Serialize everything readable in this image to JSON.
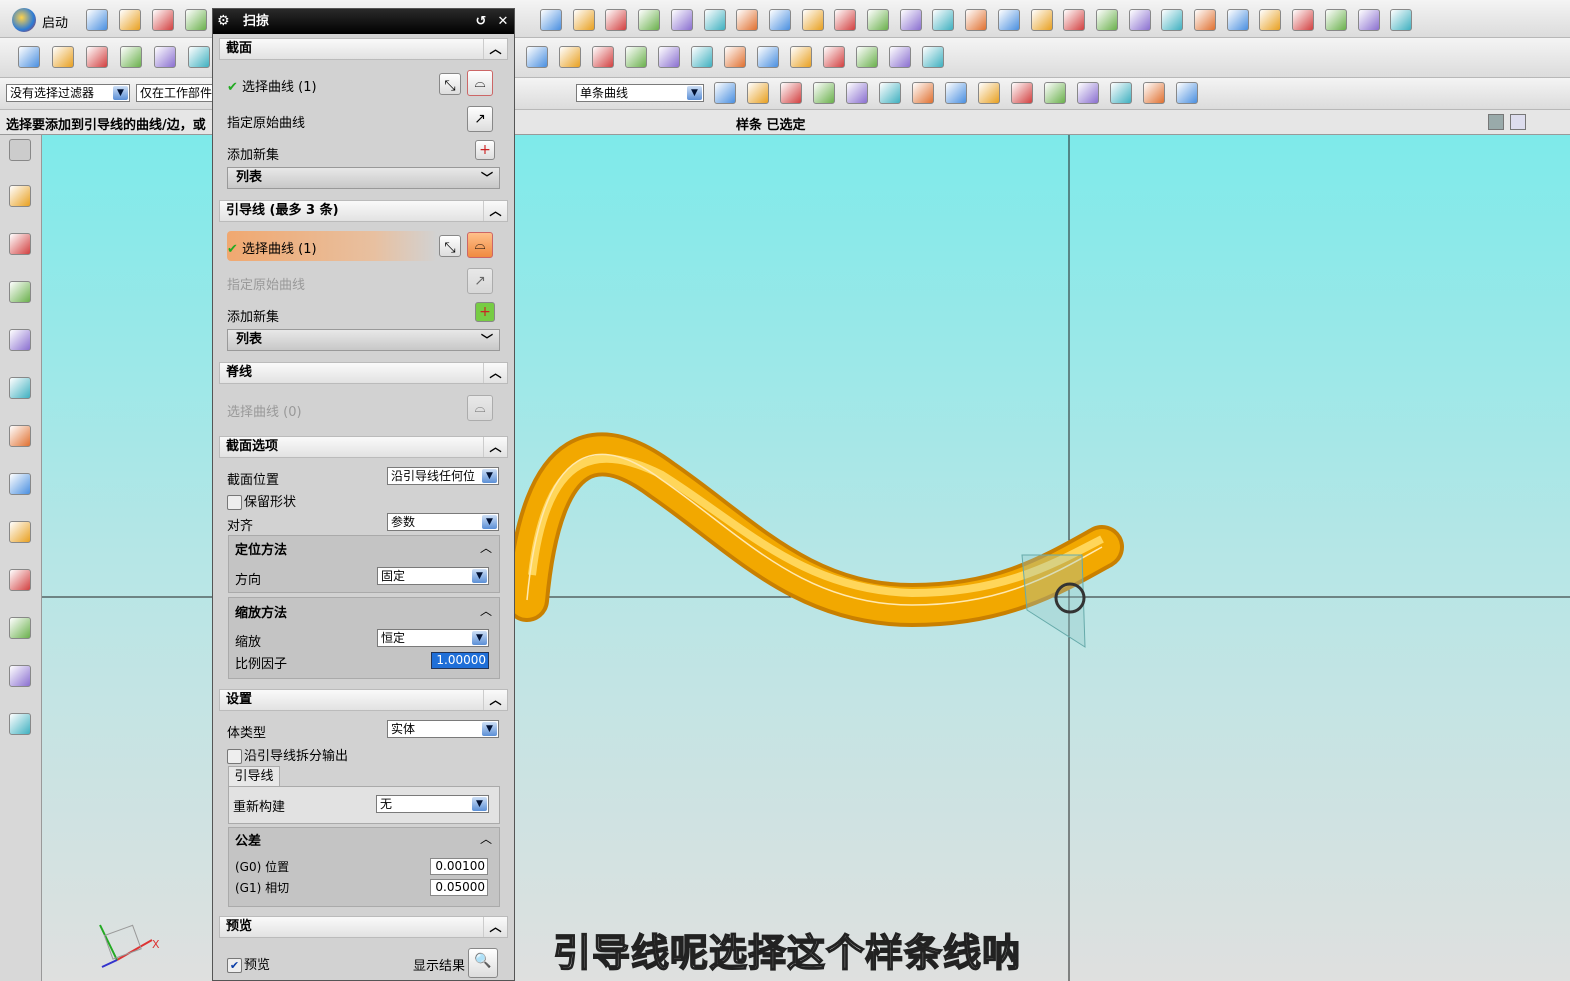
{
  "toolbar": {
    "start_label": "启动",
    "filter_value": "没有选择过滤器",
    "scope_value": "仅在工作部件",
    "curve_rule_value": "单条曲线",
    "row1_icons": [
      "new-file-icon",
      "open-folder-icon",
      "save-icon",
      "cut-icon"
    ],
    "row1_right_icons": [
      "fit-view-icon",
      "render-style-icon",
      "cube-view-icon",
      "background-icon",
      "move-icon",
      "rotate-icon",
      "sketch-icon",
      "trim-icon",
      "line-icon",
      "arc-icon",
      "shape-icon",
      "pattern-icon",
      "offset-icon",
      "book-icon",
      "ruler-icon",
      "surface-icon",
      "table-icon",
      "mesh-icon",
      "sweep-icon",
      "surface2-icon",
      "grid-icon",
      "cylinder-icon",
      "spline-icon",
      "csys-icon",
      "axis-icon",
      "box-icon",
      "block-icon"
    ],
    "row2_icons": [
      "rectangle-icon",
      "extrude-icon",
      "revolve-icon",
      "hole-icon",
      "pad-icon",
      "pattern-feature-icon"
    ],
    "row2_right_icons": [
      "ribbon-icon",
      "shell-icon",
      "boolean-icon",
      "unite-icon",
      "subtract-icon",
      "intersect-icon",
      "feature-icon",
      "edge-icon",
      "eye-icon",
      "measure-icon",
      "dimension-icon",
      "snap-icon",
      "analysis-icon"
    ],
    "row3_right_icons": [
      "stop-at-intersection-icon",
      "follow-fillet-icon",
      "arrow-right-icon",
      "snap-point-icon",
      "end-point-icon",
      "mid-point-icon",
      "control-point-icon",
      "intersection-icon",
      "quadrant-icon",
      "arc-center-icon",
      "tangent-icon",
      "point-on-curve-icon",
      "existing-point-icon",
      "face-icon",
      "grid-select-icon"
    ]
  },
  "statusbar": {
    "prompt": "选择要添加到引导线的曲线/边，或",
    "status": "样条 已选定"
  },
  "left_toolbar": [
    "settings-gear-icon",
    "assembly-navigator-icon",
    "constraints-icon",
    "part-navigator-icon",
    "reuse-library-icon",
    "history-icon",
    "web-browser-icon",
    "clock-icon",
    "palette-icon",
    "process-icon",
    "tools-icon",
    "roles-icon",
    "system-materials-icon"
  ],
  "dialog": {
    "title": "扫掠",
    "section": {
      "header": "截面",
      "select_curve": "选择曲线 (1)",
      "specify_origin": "指定原始曲线",
      "add_new_set": "添加新集",
      "list": "列表"
    },
    "guide": {
      "header": "引导线 (最多 3 条)",
      "select_curve": "选择曲线 (1)",
      "specify_origin": "指定原始曲线",
      "add_new_set": "添加新集",
      "list": "列表"
    },
    "spine": {
      "header": "脊线",
      "select_curve": "选择曲线 (0)"
    },
    "section_options": {
      "header": "截面选项",
      "position_label": "截面位置",
      "position_value": "沿引导线任何位",
      "preserve_shape": "保留形状",
      "preserve_shape_checked": false,
      "align_label": "对齐",
      "align_value": "参数",
      "orientation": {
        "header": "定位方法",
        "direction_label": "方向",
        "direction_value": "固定"
      },
      "scaling": {
        "header": "缩放方法",
        "scale_label": "缩放",
        "scale_value": "恒定",
        "factor_label": "比例因子",
        "factor_value": "1.00000"
      }
    },
    "settings": {
      "header": "设置",
      "body_type_label": "体类型",
      "body_type_value": "实体",
      "split_output": "沿引导线拆分输出",
      "split_output_checked": false,
      "tab": "引导线",
      "rebuild_label": "重新构建",
      "rebuild_value": "无",
      "tolerance": {
        "header": "公差",
        "g0_label": "(G0) 位置",
        "g0_value": "0.00100",
        "g1_label": "(G1) 相切",
        "g1_value": "0.05000"
      }
    },
    "preview": {
      "header": "预览",
      "preview_label": "预览",
      "preview_checked": true,
      "show_result": "显示结果"
    }
  },
  "viewport": {
    "background_top": "#7eeaea",
    "background_bottom": "#dfe0df",
    "body_color": "#f2a800",
    "triad_x_label": "X"
  },
  "subtitle": "引导线呢选择这个样条线呐"
}
